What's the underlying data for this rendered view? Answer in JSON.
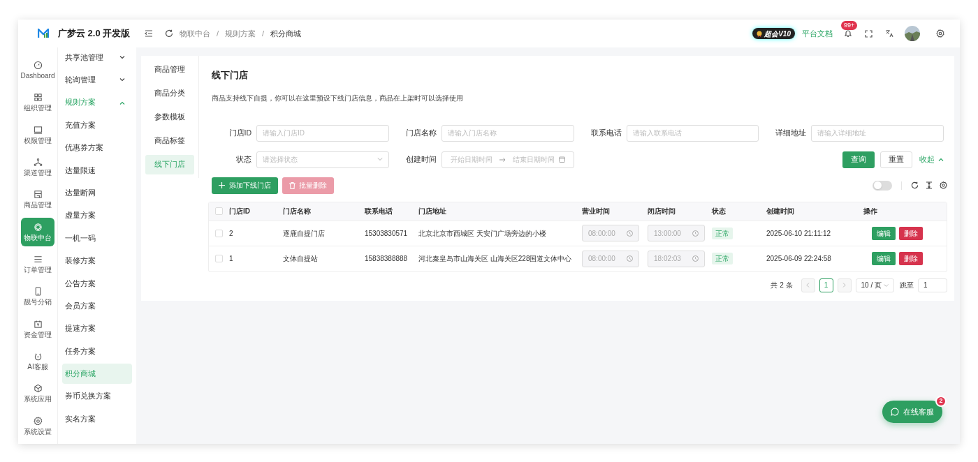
{
  "app": {
    "title": "广梦云 2.0 开发版"
  },
  "rail": [
    {
      "label": "Dashboard",
      "selected": false
    },
    {
      "label": "组织管理",
      "selected": false
    },
    {
      "label": "权限管理",
      "selected": false
    },
    {
      "label": "渠道管理",
      "selected": false
    },
    {
      "label": "商品管理",
      "selected": false
    },
    {
      "label": "物联中台",
      "selected": true
    },
    {
      "label": "订单管理",
      "selected": false
    },
    {
      "label": "靓号分销",
      "selected": false
    },
    {
      "label": "资金管理",
      "selected": false
    },
    {
      "label": "AI客服",
      "selected": false
    },
    {
      "label": "系统应用",
      "selected": false
    },
    {
      "label": "系统设置",
      "selected": false
    }
  ],
  "submenu": [
    {
      "label": "共享池管理",
      "kind": "group",
      "expanded": false
    },
    {
      "label": "轮询管理",
      "kind": "group",
      "expanded": false
    },
    {
      "label": "规则方案",
      "kind": "group",
      "expanded": true
    },
    {
      "label": "充值方案",
      "kind": "item",
      "selected": false
    },
    {
      "label": "优惠券方案",
      "kind": "item",
      "selected": false
    },
    {
      "label": "达量限速",
      "kind": "item",
      "selected": false
    },
    {
      "label": "达量断网",
      "kind": "item",
      "selected": false
    },
    {
      "label": "虚量方案",
      "kind": "item",
      "selected": false
    },
    {
      "label": "一机一码",
      "kind": "item",
      "selected": false
    },
    {
      "label": "装修方案",
      "kind": "item",
      "selected": false
    },
    {
      "label": "公告方案",
      "kind": "item",
      "selected": false
    },
    {
      "label": "会员方案",
      "kind": "item",
      "selected": false
    },
    {
      "label": "提速方案",
      "kind": "item",
      "selected": false
    },
    {
      "label": "任务方案",
      "kind": "item",
      "selected": false
    },
    {
      "label": "积分商城",
      "kind": "item",
      "selected": true
    },
    {
      "label": "券币兑换方案",
      "kind": "item",
      "selected": false
    },
    {
      "label": "实名方案",
      "kind": "item",
      "selected": false
    }
  ],
  "header": {
    "breadcrumbs": [
      {
        "kind": "link",
        "text": "物联中台"
      },
      {
        "kind": "separator",
        "text": "/"
      },
      {
        "kind": "link",
        "text": "规则方案"
      },
      {
        "kind": "separator",
        "text": "/"
      },
      {
        "kind": "current",
        "text": "积分商城"
      }
    ],
    "vip_badge": "超会V10",
    "docs_link": "平台文档",
    "notification_count": "99+"
  },
  "tabs": [
    {
      "label": "商品管理",
      "selected": false
    },
    {
      "label": "商品分类",
      "selected": false
    },
    {
      "label": "参数模板",
      "selected": false
    },
    {
      "label": "商品标签",
      "selected": false
    },
    {
      "label": "线下门店",
      "selected": true
    }
  ],
  "page": {
    "title": "线下门店",
    "description": "商品支持线下自提，你可以在这里预设下线门店信息，商品在上架时可以选择使用"
  },
  "filters": [
    {
      "label": "门店ID",
      "kind": "input",
      "placeholder": "请输入门店ID"
    },
    {
      "label": "门店名称",
      "kind": "input",
      "placeholder": "请输入门店名称"
    },
    {
      "label": "联系电话",
      "kind": "input",
      "placeholder": "请输入联系电话"
    },
    {
      "label": "详细地址",
      "kind": "input",
      "placeholder": "请输入详细地址"
    },
    {
      "label": "状态",
      "kind": "select",
      "placeholder": "请选择状态"
    },
    {
      "label": "创建时间",
      "kind": "daterange",
      "start_placeholder": "开始日期时间",
      "end_placeholder": "结束日期时间"
    }
  ],
  "filter_actions": {
    "query": "查询",
    "reset": "重置",
    "collapse": "收起"
  },
  "toolbar": {
    "add": "添加下线门店",
    "batch_delete": "批量删除",
    "batch_delete_disabled": true,
    "toggle_on": false
  },
  "table": {
    "columns": [
      "门店ID",
      "门店名称",
      "联系电话",
      "门店地址",
      "营业时间",
      "闭店时间",
      "状态",
      "创建时间",
      "操作"
    ],
    "all_checked": false,
    "rows": [
      {
        "checked": false,
        "id": "2",
        "name": "逐鹿自提门店",
        "phone": "15303830571",
        "address": "北京北京市西城区 天安门广场旁边的小楼",
        "open_time": "08:00:00",
        "close_time": "13:00:00",
        "status": "正常",
        "created": "2025-06-10 21:11:12",
        "actions": [
          "编辑",
          "删除"
        ]
      },
      {
        "checked": false,
        "id": "1",
        "name": "文体自提站",
        "phone": "15838388888",
        "address": "河北秦皇岛市山海关区 山海关区228国道文体中心",
        "open_time": "08:00:00",
        "close_time": "18:02:03",
        "status": "正常",
        "created": "2025-06-09 22:24:58",
        "actions": [
          "编辑",
          "删除"
        ]
      }
    ]
  },
  "pagination": {
    "total": "共 2 条",
    "current": "1",
    "page_size": "10 / 页",
    "jump_label": "跳至",
    "jump_value": "1"
  },
  "chat": {
    "label": "在线客服",
    "badge": "2"
  }
}
